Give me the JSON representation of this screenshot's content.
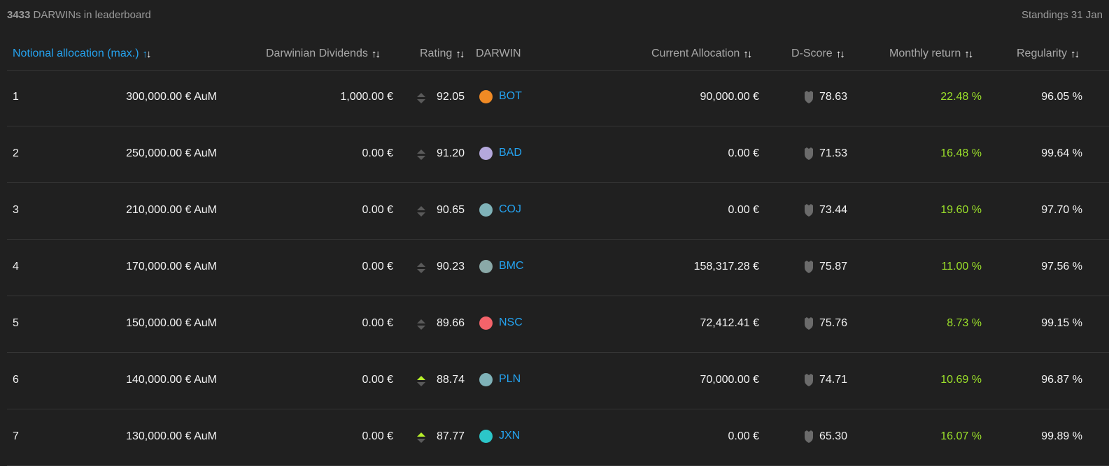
{
  "header": {
    "count_number": "3433",
    "count_label": "DARWINs in leaderboard",
    "standings": "Standings 31 Jan"
  },
  "columns": {
    "notional": "Notional allocation (max.)",
    "dividends": "Darwinian Dividends",
    "rating": "Rating",
    "darwin": "DARWIN",
    "current_allocation": "Current Allocation",
    "dscore": "D-Score",
    "monthly": "Monthly return",
    "regularity": "Regularity"
  },
  "icons": {
    "sort": "sort-arrows-icon",
    "rating_trend": "rating-trend-icon",
    "dscore": "shield-icon"
  },
  "colors": {
    "accent": "#25a3f0",
    "positive": "#9be02a",
    "trend_up": "#b7f02a",
    "background": "#202020"
  },
  "rows": [
    {
      "rank": "1",
      "notional": "300,000.00 € AuM",
      "dividends": "1,000.00 €",
      "trend": "neutral",
      "rating": "92.05",
      "dot_color": "#f08a24",
      "ticker": "BOT",
      "allocation": "90,000.00 €",
      "dscore": "78.63",
      "monthly": "22.48 %",
      "regularity": "96.05 %"
    },
    {
      "rank": "2",
      "notional": "250,000.00 € AuM",
      "dividends": "0.00 €",
      "trend": "neutral",
      "rating": "91.20",
      "dot_color": "#b4a8dc",
      "ticker": "BAD",
      "allocation": "0.00 €",
      "dscore": "71.53",
      "monthly": "16.48 %",
      "regularity": "99.64 %"
    },
    {
      "rank": "3",
      "notional": "210,000.00 € AuM",
      "dividends": "0.00 €",
      "trend": "neutral",
      "rating": "90.65",
      "dot_color": "#7fb2b8",
      "ticker": "COJ",
      "allocation": "0.00 €",
      "dscore": "73.44",
      "monthly": "19.60 %",
      "regularity": "97.70 %"
    },
    {
      "rank": "4",
      "notional": "170,000.00 € AuM",
      "dividends": "0.00 €",
      "trend": "neutral",
      "rating": "90.23",
      "dot_color": "#8aa9a8",
      "ticker": "BMC",
      "allocation": "158,317.28 €",
      "dscore": "75.87",
      "monthly": "11.00 %",
      "regularity": "97.56 %"
    },
    {
      "rank": "5",
      "notional": "150,000.00 € AuM",
      "dividends": "0.00 €",
      "trend": "neutral",
      "rating": "89.66",
      "dot_color": "#f4636a",
      "ticker": "NSC",
      "allocation": "72,412.41 €",
      "dscore": "75.76",
      "monthly": "8.73 %",
      "regularity": "99.15 %"
    },
    {
      "rank": "6",
      "notional": "140,000.00 € AuM",
      "dividends": "0.00 €",
      "trend": "up",
      "rating": "88.74",
      "dot_color": "#7fb2b8",
      "ticker": "PLN",
      "allocation": "70,000.00 €",
      "dscore": "74.71",
      "monthly": "10.69 %",
      "regularity": "96.87 %"
    },
    {
      "rank": "7",
      "notional": "130,000.00 € AuM",
      "dividends": "0.00 €",
      "trend": "up",
      "rating": "87.77",
      "dot_color": "#2cc6c9",
      "ticker": "JXN",
      "allocation": "0.00 €",
      "dscore": "65.30",
      "monthly": "16.07 %",
      "regularity": "99.89 %"
    }
  ]
}
